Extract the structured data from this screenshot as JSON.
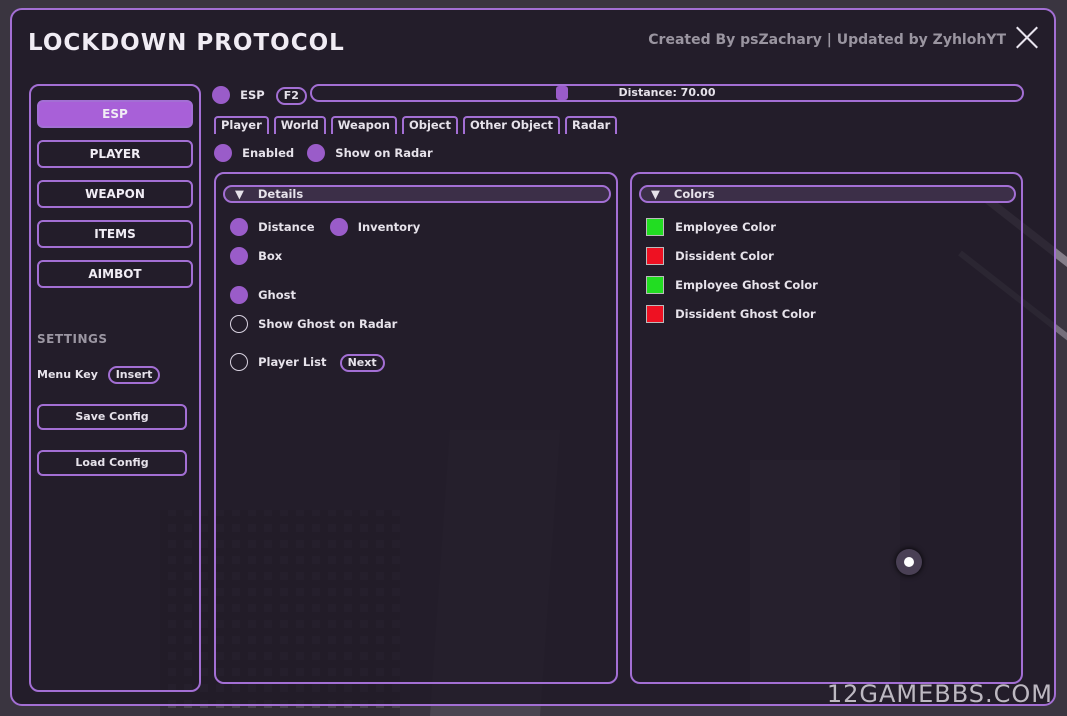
{
  "window": {
    "title": "LOCKDOWN PROTOCOL",
    "credits": "Created By psZachary | Updated by ZyhlohYT"
  },
  "sidebar": {
    "items": [
      {
        "label": "ESP",
        "active": true
      },
      {
        "label": "PLAYER"
      },
      {
        "label": "WEAPON"
      },
      {
        "label": "ITEMS"
      },
      {
        "label": "AIMBOT"
      }
    ],
    "settings_heading": "SETTINGS",
    "menu_key_label": "Menu Key",
    "menu_key_value": "Insert",
    "save_config": "Save Config",
    "load_config": "Load Config"
  },
  "esp": {
    "label": "ESP",
    "hotkey": "F2",
    "distance_text": "Distance: 70.00",
    "distance_value": 70.0,
    "tabs": [
      "Player",
      "World",
      "Weapon",
      "Object",
      "Other Object",
      "Radar"
    ],
    "enabled_label": "Enabled",
    "show_on_radar_label": "Show on Radar"
  },
  "details": {
    "header": "Details",
    "distance": "Distance",
    "inventory": "Inventory",
    "box": "Box",
    "ghost": "Ghost",
    "show_ghost_on_radar": "Show Ghost on Radar",
    "player_list": "Player List",
    "next": "Next"
  },
  "colors": {
    "header": "Colors",
    "items": [
      {
        "label": "Employee Color",
        "color": "#22dd22"
      },
      {
        "label": "Dissident Color",
        "color": "#ee1122"
      },
      {
        "label": "Employee Ghost Color",
        "color": "#22dd22"
      },
      {
        "label": "Dissident Ghost Color",
        "color": "#ee1122"
      }
    ]
  },
  "theme": {
    "accent": "#a36fd4",
    "active": "#a860d8"
  },
  "watermark": "12GAMEBBS.COM"
}
